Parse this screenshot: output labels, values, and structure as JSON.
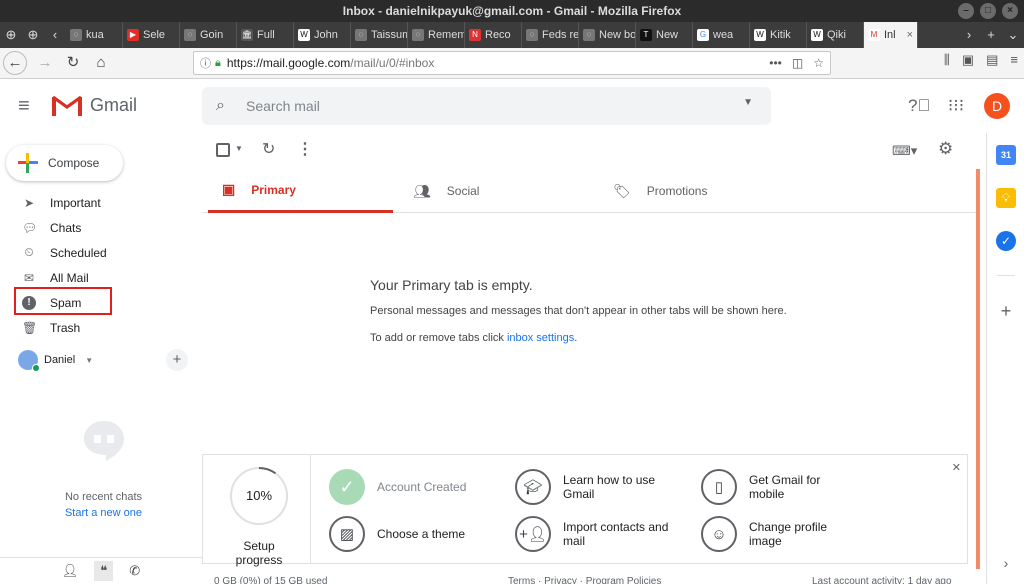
{
  "window": {
    "title": "Inbox - danielnikpayuk@gmail.com - Gmail - Mozilla Firefox"
  },
  "browser": {
    "tabs": [
      {
        "label": "kua",
        "icon": "generic-icon"
      },
      {
        "label": "Sele",
        "icon": "youtube-icon"
      },
      {
        "label": "Goin",
        "icon": "generic-icon"
      },
      {
        "label": "Full",
        "icon": "bank-icon"
      },
      {
        "label": "John",
        "icon": "w-icon"
      },
      {
        "label": "Taissum",
        "icon": "generic-icon"
      },
      {
        "label": "Remem",
        "icon": "generic-icon"
      },
      {
        "label": "Reco",
        "icon": "news-icon"
      },
      {
        "label": "Feds re",
        "icon": "generic-icon"
      },
      {
        "label": "New bo",
        "icon": "generic-icon"
      },
      {
        "label": "New",
        "icon": "t-icon"
      },
      {
        "label": "wea",
        "icon": "google-icon"
      },
      {
        "label": "Kitik",
        "icon": "w-icon"
      },
      {
        "label": "Qiki",
        "icon": "w-icon"
      },
      {
        "label": "Inl",
        "icon": "gmail-icon",
        "active": true
      }
    ],
    "url_host": "https://mail.google.com",
    "url_rest": "/mail/u/0/#inbox"
  },
  "gmail": {
    "logo_text": "Gmail",
    "search_placeholder": "Search mail",
    "avatar_letter": "D",
    "compose_label": "Compose",
    "nav_items": [
      {
        "label": "Important",
        "icon": "important-icon"
      },
      {
        "label": "Chats",
        "icon": "chat-icon"
      },
      {
        "label": "Scheduled",
        "icon": "scheduled-icon"
      },
      {
        "label": "All Mail",
        "icon": "mail-icon"
      },
      {
        "label": "Spam",
        "icon": "spam-icon"
      },
      {
        "label": "Trash",
        "icon": "trash-icon"
      }
    ],
    "hangouts_user": "Daniel",
    "no_chats": "No recent chats",
    "start_chat": "Start a new one",
    "tabs": [
      {
        "label": "Primary",
        "icon": "inbox-icon"
      },
      {
        "label": "Social",
        "icon": "people-icon"
      },
      {
        "label": "Promotions",
        "icon": "tag-icon"
      }
    ],
    "empty": {
      "title": "Your Primary tab is empty.",
      "desc": "Personal messages and messages that don't appear in other tabs will be shown here.",
      "settings_prefix": "To add or remove tabs click ",
      "settings_link": "inbox settings",
      "settings_suffix": "."
    },
    "setup": {
      "progress_percent": 10,
      "progress_text": "10%",
      "progress_label": "Setup progress",
      "steps": [
        {
          "label": "Account Created",
          "icon": "check-icon",
          "done": true
        },
        {
          "label": "Learn how to use Gmail",
          "icon": "graduation-cap-icon",
          "done": false
        },
        {
          "label": "Get Gmail for mobile",
          "icon": "phone-icon",
          "done": false
        },
        {
          "label": "Choose a theme",
          "icon": "image-icon",
          "done": false
        },
        {
          "label": "Import contacts and mail",
          "icon": "add-person-icon",
          "done": false
        },
        {
          "label": "Change profile image",
          "icon": "account-icon",
          "done": false
        }
      ]
    },
    "footer": {
      "storage": "0 GB (0%) of 15 GB used",
      "links": "Terms · Privacy · Program Policies",
      "activity": "Last account activity: 1 day ago"
    },
    "side_panel": {
      "calendar_day": "31"
    }
  },
  "colors": {
    "gmail_red": "#d93025",
    "link_blue": "#1a73e8",
    "avatar_orange": "#f4511e",
    "highlight_box": "#e0201c",
    "done_green": "#a8dab5"
  }
}
